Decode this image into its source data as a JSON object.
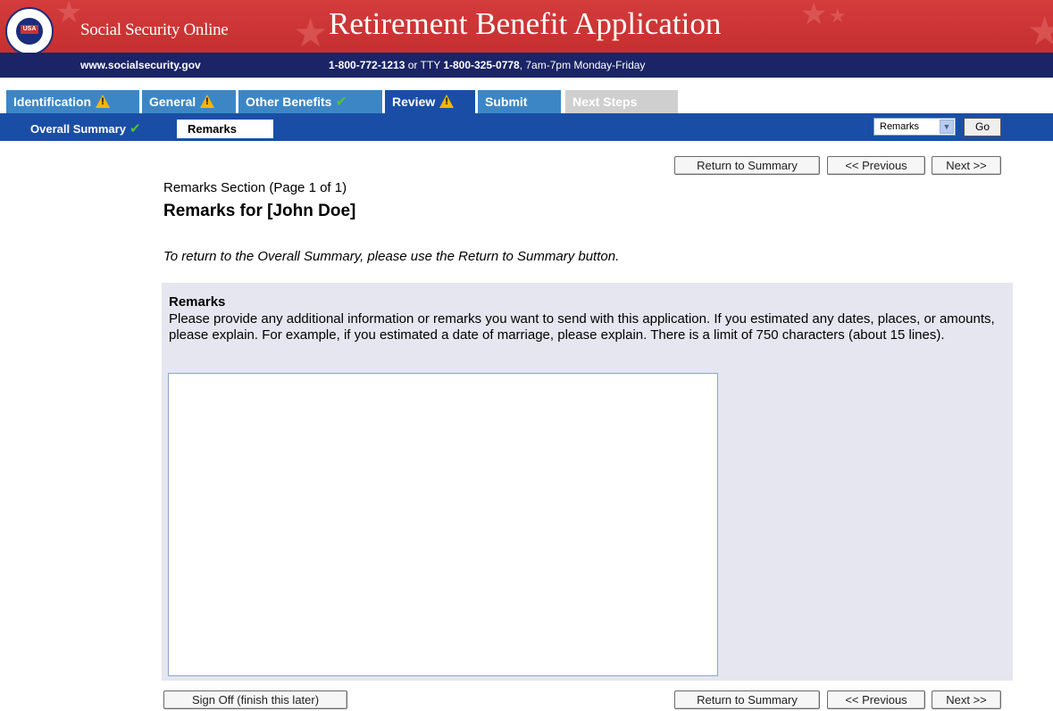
{
  "header": {
    "site_name": "Social Security Online",
    "app_title": "Retirement Benefit Application",
    "url": "www.socialsecurity.gov",
    "phone_primary": "1-800-772-1213",
    "phone_or": " or TTY ",
    "phone_tty": "1-800-325-0778",
    "hours": ", 7am-7pm Monday-Friday",
    "seal_text": "USA"
  },
  "tabs": [
    {
      "label": "Identification",
      "status": "warning-icon"
    },
    {
      "label": "General",
      "status": "warning-icon"
    },
    {
      "label": "Other Benefits",
      "status": "check-icon"
    },
    {
      "label": "Review",
      "status": "warning-icon"
    },
    {
      "label": "Submit",
      "status": ""
    },
    {
      "label": "Next Steps",
      "status": ""
    }
  ],
  "subnav": {
    "overall_summary": "Overall Summary",
    "current": "Remarks",
    "select_value": "Remarks",
    "go_label": "Go"
  },
  "nav_buttons": {
    "return_summary": "Return to Summary",
    "previous": "<< Previous",
    "next": "Next >>",
    "sign_off": "Sign Off (finish this later)"
  },
  "content": {
    "section_line": "Remarks Section (Page 1 of 1)",
    "section_title": "Remarks for [John Doe]",
    "instruction": "To return to the Overall Summary, please use the Return to Summary button.",
    "remarks_label": "Remarks",
    "remarks_description": "Please provide any additional information or remarks you want to send with this application. If you estimated any dates, places, or amounts, please explain. For example, if you estimated a date of marriage, please explain. There is a limit of 750 characters (about 15 lines).",
    "remarks_value": ""
  },
  "colors": {
    "banner_red": "#cc3333",
    "info_bar": "#1a2466",
    "tab_blue": "#3d86c6",
    "tab_active": "#1a4ea6",
    "panel_bg": "#e6e6f0"
  }
}
